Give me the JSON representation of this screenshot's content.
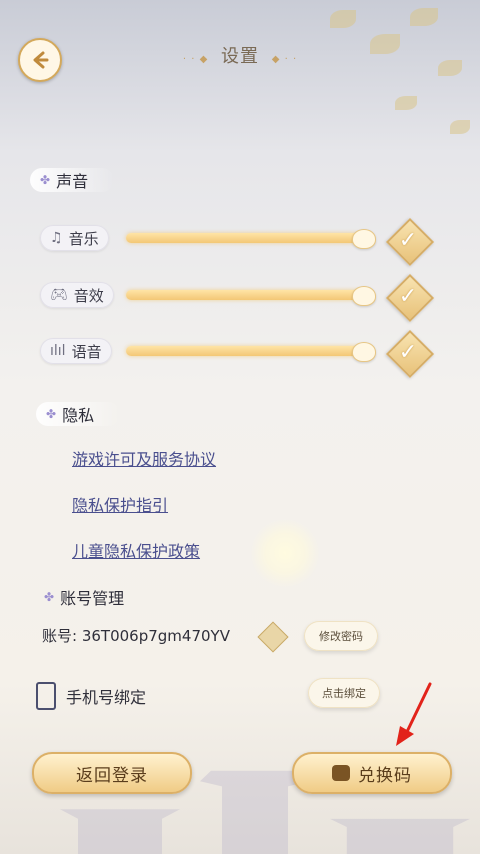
{
  "header": {
    "title": "设置",
    "back_icon": "back-arrow-icon"
  },
  "sound": {
    "label": "声音",
    "items": [
      {
        "label": "音乐",
        "icon": "music-note-icon",
        "level": 1.0,
        "enabled": true
      },
      {
        "label": "音效",
        "icon": "gamepad-icon",
        "level": 1.0,
        "enabled": true
      },
      {
        "label": "语音",
        "icon": "voice-wave-icon",
        "level": 1.0,
        "enabled": true
      }
    ]
  },
  "privacy": {
    "label": "隐私",
    "links": [
      {
        "label": "游戏许可及服务协议"
      },
      {
        "label": "隐私保护指引"
      },
      {
        "label": "儿童隐私保护政策"
      }
    ]
  },
  "account": {
    "label": "账号管理",
    "id_label": "账号:",
    "id_value": "36T006p7gm470YV",
    "change_password": "修改密码",
    "phone_label": "手机号绑定",
    "bind_button": "点击绑定"
  },
  "footer": {
    "back_login": "返回登录",
    "redeem": "兑换码"
  },
  "colors": {
    "accent": "#f0cc86",
    "link": "#4a4f8e",
    "annotation_arrow": "#e2231a"
  }
}
